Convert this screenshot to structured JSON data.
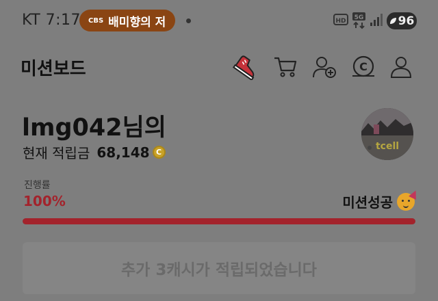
{
  "status_bar": {
    "carrier_time": "KT 7:17",
    "media_source": "CBS",
    "media_title": "배미향의 저",
    "battery": "96",
    "icons": [
      "hd-voice-icon",
      "5g-data-icon",
      "signal-icon",
      "battery-icon"
    ]
  },
  "header": {
    "title": "미션보드",
    "icons": [
      "sneaker-icon",
      "cart-icon",
      "add-friend-icon",
      "cash-coin-icon",
      "profile-icon"
    ]
  },
  "profile": {
    "user_name": "lmg042님의",
    "points_label": "현재 적립금",
    "points_value": "68,148",
    "coin_symbol": "C"
  },
  "progress": {
    "label": "진행률",
    "value_text": "100%",
    "fraction": 1.0,
    "status_text": "미션성공"
  },
  "notice": {
    "text": "추가 3캐시가 적립되었습니다"
  },
  "colors": {
    "accent": "#a3232c",
    "overlay": "#7e7e7e",
    "media_pill": "#8a4513"
  }
}
